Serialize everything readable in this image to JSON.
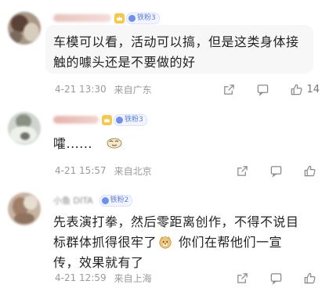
{
  "comments": [
    {
      "fan_level": "铁粉3",
      "text": "车模可以看，活动可以搞，但是这类身体接触的噱头还是不要做的好",
      "date": "4-21 13:30",
      "location": "来自广东",
      "like_count": "14"
    },
    {
      "fan_level": "铁粉3",
      "text": "嚯......",
      "date": "4-21 15:57",
      "location": "来自北京",
      "like_count": ""
    },
    {
      "username_partial": "小鱼 DITA",
      "fan_level": "铁粉2",
      "text_part1": "先表演打拳，然后零距离创作，不得不说目标群体抓得很牢了",
      "text_part2": "你们在帮他们一宣传，效果就有了",
      "date": "4-21 12:59",
      "location": "来自上海",
      "like_count": ""
    }
  ],
  "icons": {
    "crown": "crown-icon",
    "emoji_smirk": "smirk-emoji-icon",
    "emoji_doge": "doge-emoji-icon",
    "share": "share-icon",
    "comment": "comment-icon",
    "like": "thumbs-up-icon"
  },
  "colors": {
    "bubble_bg": "#f7f7f7",
    "meta_text": "#9a9a9a",
    "badge_blue": "#5b7bd6",
    "crown_gold": "#f7c64b"
  }
}
